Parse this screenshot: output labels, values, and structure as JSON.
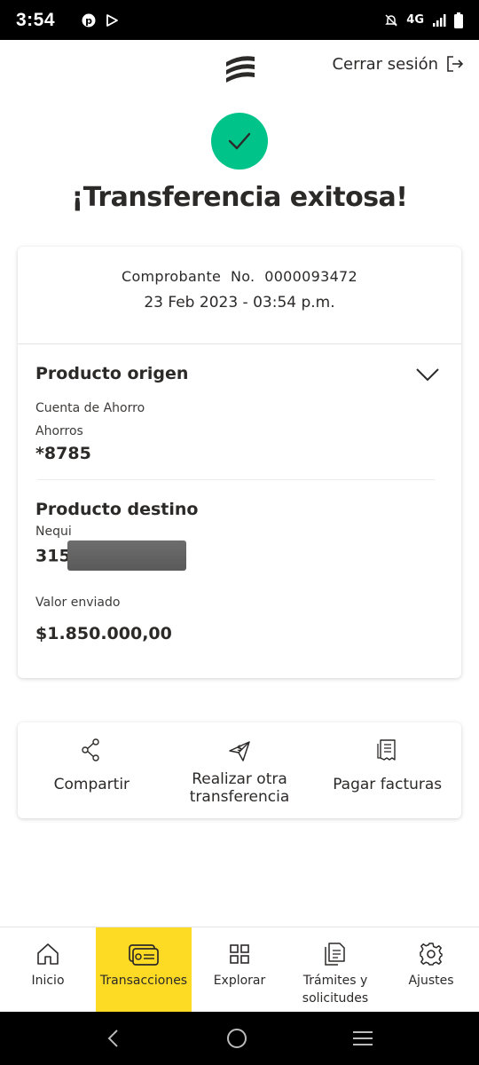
{
  "status_bar": {
    "time": "3:54",
    "network": "4G"
  },
  "header": {
    "logout_label": "Cerrar sesión"
  },
  "title": "¡Transferencia exitosa!",
  "receipt": {
    "number": "Comprobante  No.  0000093472",
    "date": "23 Feb 2023 - 03:54 p.m."
  },
  "origin": {
    "title": "Producto origen",
    "account_type": "Cuenta de Ahorro",
    "account_subtype": "Ahorros",
    "account_number": "*8785"
  },
  "destination": {
    "title": "Producto destino",
    "bank": "Nequi",
    "number_prefix": "315",
    "amount_label": "Valor enviado",
    "amount": "$1.850.000,00"
  },
  "actions": [
    {
      "label": "Compartir",
      "icon": "share-icon"
    },
    {
      "label": "Realizar otra transferencia",
      "icon": "send-money-icon"
    },
    {
      "label": "Pagar facturas",
      "icon": "bill-icon"
    }
  ],
  "bottom_nav": [
    {
      "label": "Inicio",
      "icon": "home-icon"
    },
    {
      "label": "Transacciones",
      "icon": "transactions-icon",
      "active": true
    },
    {
      "label": "Explorar",
      "icon": "grid-icon"
    },
    {
      "label": "Trámites y solicitudes",
      "icon": "documents-icon"
    },
    {
      "label": "Ajustes",
      "icon": "gear-icon"
    }
  ],
  "colors": {
    "success": "#00c389",
    "accent": "#fdda24",
    "text": "#2c2a29"
  }
}
